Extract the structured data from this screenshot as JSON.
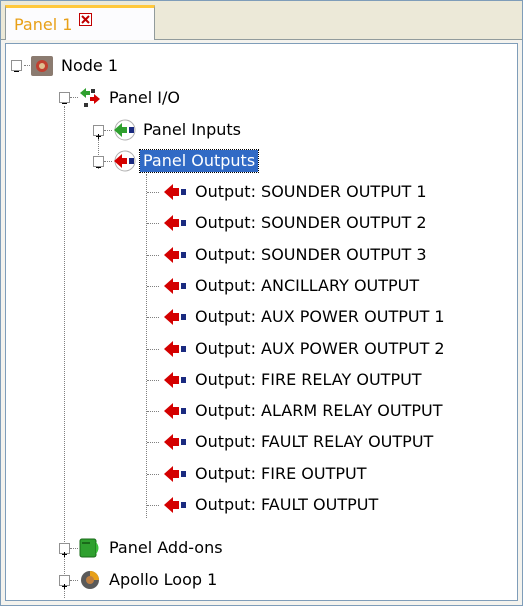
{
  "tab": {
    "label": "Panel 1"
  },
  "tree": {
    "node": {
      "label": "Node 1"
    },
    "panel_io": {
      "label": "Panel I/O"
    },
    "panel_inputs": {
      "label": "Panel Inputs"
    },
    "panel_outputs": {
      "label": "Panel Outputs"
    },
    "outputs": [
      "Output: SOUNDER OUTPUT 1",
      "Output: SOUNDER OUTPUT 2",
      "Output: SOUNDER OUTPUT 3",
      "Output: ANCILLARY OUTPUT",
      "Output: AUX POWER OUTPUT 1",
      "Output: AUX POWER OUTPUT 2",
      "Output: FIRE RELAY OUTPUT",
      "Output: ALARM RELAY OUTPUT",
      "Output: FAULT RELAY OUTPUT",
      "Output: FIRE OUTPUT",
      "Output: FAULT OUTPUT"
    ],
    "panel_addons": {
      "label": "Panel Add-ons"
    },
    "apollo_loop": {
      "label": "Apollo Loop 1"
    }
  },
  "colors": {
    "selection": "#316ac5",
    "tab_accent": "#ffc83c",
    "tab_text": "#e8a018",
    "output_arrow": "#d40000"
  }
}
